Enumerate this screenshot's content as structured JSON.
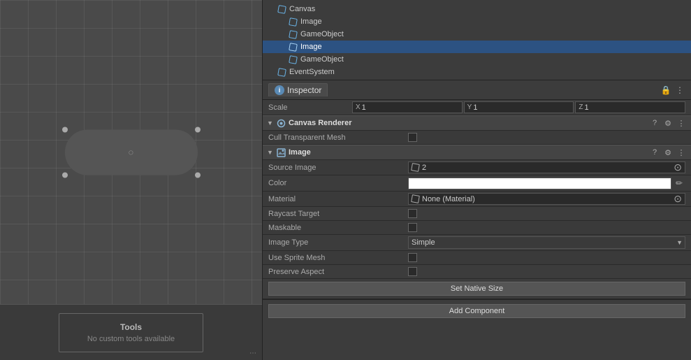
{
  "hierarchy": {
    "items": [
      {
        "id": "canvas",
        "label": "Canvas",
        "indent": 0,
        "selected": false
      },
      {
        "id": "image1",
        "label": "Image",
        "indent": 1,
        "selected": false
      },
      {
        "id": "gameobject1",
        "label": "GameObject",
        "indent": 1,
        "selected": false
      },
      {
        "id": "image2",
        "label": "Image",
        "indent": 1,
        "selected": true
      },
      {
        "id": "gameobject2",
        "label": "GameObject",
        "indent": 1,
        "selected": false
      },
      {
        "id": "eventsystem",
        "label": "EventSystem",
        "indent": 0,
        "selected": false
      }
    ]
  },
  "inspector": {
    "title": "Inspector",
    "scale": {
      "label": "Scale",
      "x": "1",
      "y": "1",
      "z": "1"
    },
    "canvas_renderer": {
      "name": "Canvas Renderer",
      "cull_transparent_mesh": {
        "label": "Cull Transparent Mesh",
        "checked": false
      }
    },
    "image_component": {
      "name": "Image",
      "source_image": {
        "label": "Source Image",
        "value": "2"
      },
      "color": {
        "label": "Color"
      },
      "material": {
        "label": "Material",
        "value": "None (Material)"
      },
      "raycast_target": {
        "label": "Raycast Target",
        "checked": false
      },
      "maskable": {
        "label": "Maskable",
        "checked": false
      },
      "image_type": {
        "label": "Image Type",
        "value": "Simple"
      },
      "use_sprite_mesh": {
        "label": "Use Sprite Mesh",
        "checked": false
      },
      "preserve_aspect": {
        "label": "Preserve Aspect",
        "checked": false
      },
      "set_native_size_btn": "Set Native Size"
    },
    "add_component_btn": "Add Component"
  },
  "tools": {
    "title": "Tools",
    "subtitle": "No custom tools available"
  },
  "colors": {
    "accent_blue": "#5a8ab5",
    "selected_bg": "#2c5282",
    "component_bg": "#444444"
  }
}
